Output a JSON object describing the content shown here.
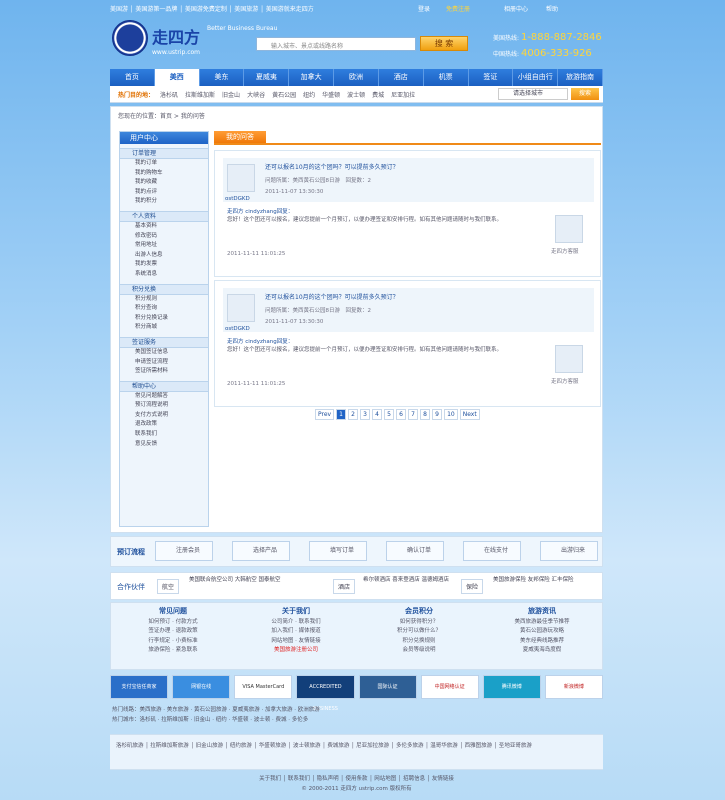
{
  "topbar": {
    "announce": "美国游 │ 美国游第一品牌 │ 美国游免费定制 │ 美国旅游 │ 美国游就来走四方",
    "links": [
      "登录",
      "免费注册",
      "相册中心",
      "帮助"
    ]
  },
  "brand": {
    "name": "走四方",
    "slogan": "Better Business Bureau",
    "site": "www.ustrip.com"
  },
  "search": {
    "placeholder": "输入城市、景点或线路名称",
    "button": "搜 索"
  },
  "phones": {
    "label1": "美国热线:",
    "number1": "1-888-887-2846",
    "label2": "中国热线:",
    "number2": "4006-333-926"
  },
  "nav": [
    "首页",
    "美西",
    "美东",
    "夏威夷",
    "加拿大",
    "欧洲",
    "酒店",
    "机票",
    "签证",
    "小组自由行",
    "旅游指南"
  ],
  "subnav": {
    "label": "热门目的地：",
    "items": [
      "洛杉矶",
      "拉斯维加斯",
      "旧金山",
      "大峡谷",
      "黄石公园",
      "纽约",
      "华盛顿",
      "波士顿",
      "费城",
      "尼亚加拉",
      "奥兰多",
      "多伦多"
    ],
    "select": "请选择城市",
    "go": "搜索"
  },
  "crumb": "您现在的位置：首页 > 我的问答",
  "sidebar": {
    "title": "用户中心",
    "groups": [
      {
        "title": "订单管理",
        "items": [
          "我的订单",
          "我的购物车",
          "我的收藏",
          "我的点评",
          "我的积分"
        ]
      },
      {
        "title": "个人资料",
        "items": [
          "基本资料",
          "修改密码",
          "常用地址",
          "出游人信息",
          "我的发票",
          "系统消息"
        ]
      },
      {
        "title": "积分兑换",
        "items": [
          "积分规则",
          "积分查询",
          "积分兑换记录",
          "积分商城"
        ]
      },
      {
        "title": "签证服务",
        "items": [
          "美国签证信息",
          "申请签证流程",
          "签证所需材料"
        ]
      },
      {
        "title": "帮助中心",
        "items": [
          "常见问题解答",
          "预订流程说明",
          "支付方式说明",
          "退改政策",
          "联系我们",
          "意见反馈"
        ]
      }
    ]
  },
  "tab": "我的问答",
  "qa": [
    {
      "question": "还可以报名10月的这个团吗？可以提前多久预订？",
      "meta": "问题所属：美西黄石公园8日游　回复数：2",
      "user": "ostDGKD",
      "time": "2011-11-07 13:30:30",
      "staff": "走四方 cindyzhang回复：",
      "answer": "您好！这个团还可以报名，建议您提前一个月预订，以便办理签证和安排行程。如有其他问题请随时与我们联系。",
      "answer_time": "2011-11-11 11:01:25",
      "staff_label": "走四方客服"
    },
    {
      "question": "还可以报名10月的这个团吗？可以提前多久预订？",
      "meta": "问题所属：美西黄石公园8日游　回复数：2",
      "user": "ostDGKD",
      "time": "2011-11-07 13:30:30",
      "staff": "走四方 cindyzhang回复：",
      "answer": "您好！这个团还可以报名，建议您提前一个月预订，以便办理签证和安排行程。如有其他问题请随时与我们联系。",
      "answer_time": "2011-11-11 11:01:25",
      "staff_label": "走四方客服"
    }
  ],
  "pager": [
    "Prev",
    "1",
    "2",
    "3",
    "4",
    "5",
    "6",
    "7",
    "8",
    "9",
    "10",
    "Next"
  ],
  "flow": {
    "title": "预订流程",
    "steps": [
      "注册会员",
      "选择产品",
      "填写订单",
      "确认订单",
      "在线支付",
      "出游归来"
    ]
  },
  "partners": {
    "title": "合作伙伴",
    "items": [
      {
        "tag": "航空",
        "text": "美国联合航空公司 大韩航空 国泰航空"
      },
      {
        "tag": "酒店",
        "text": "希尔顿酒店 喜来登酒店 温德姆酒店"
      },
      {
        "tag": "保险",
        "text": "美国旅游保险 友邦保险 汇丰保险"
      }
    ]
  },
  "info": [
    {
      "title": "常见问题",
      "lines": [
        "如何预订 · 付款方式",
        "签证办理 · 退款政策",
        "行李规定 · 小费标准",
        "旅游保险 · 紧急联系"
      ]
    },
    {
      "title": "关于我们",
      "lines": [
        "公司简介 · 联系我们",
        "加入我们 · 媒体报道",
        "网站地图 · 友情链接",
        "美国旅游注册公司"
      ]
    },
    {
      "title": "会员积分",
      "lines": [
        "如何获得积分？",
        "积分可以做什么？",
        "积分兑换规则",
        "会员等级说明"
      ]
    },
    {
      "title": "旅游资讯",
      "lines": [
        "美西旅游最佳季节推荐",
        "黄石公园游玩攻略",
        "美东经典线路推荐",
        "夏威夷海岛度假"
      ]
    }
  ],
  "badges": [
    "支付宝信任商家",
    "网银在线",
    "VISA MasterCard",
    "ACCREDITED BUSINESS",
    "国际认证",
    "中国网络认证",
    "腾讯微博",
    "新浪微博"
  ],
  "lines": [
    "热门线路：美西旅游 · 美东旅游 · 黄石公园旅游 · 夏威夷旅游 · 加拿大旅游 · 欧洲旅游",
    "热门城市：洛杉矶 · 拉斯维加斯 · 旧金山 · 纽约 · 华盛顿 · 波士顿 · 费城 · 多伦多"
  ],
  "footer": {
    "links": "洛杉矶旅游 │ 拉斯维加斯旅游 │ 旧金山旅游 │ 纽约旅游 │ 华盛顿旅游 │ 波士顿旅游 │ 费城旅游 │ 尼亚加拉旅游 │ 多伦多旅游 │ 温哥华旅游 │ 西雅图旅游 │ 圣地亚哥旅游",
    "menu": "关于我们 │ 联系我们 │ 隐私声明 │ 使用条款 │ 网站地图 │ 招聘信息 │ 友情链接",
    "copyright": "© 2000-2011 走四方 ustrip.com 版权所有"
  }
}
